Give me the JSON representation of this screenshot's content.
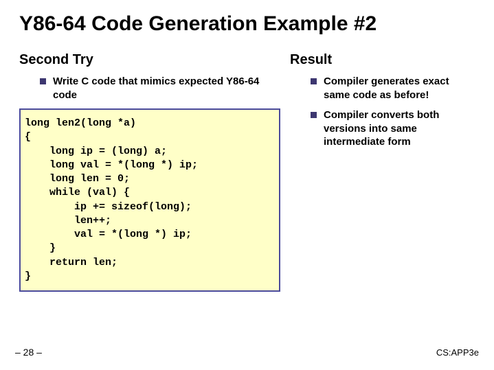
{
  "title": "Y86-64 Code Generation Example #2",
  "left": {
    "heading": "Second Try",
    "bullets": [
      "Write C code that mimics expected Y86-64 code"
    ],
    "code": "long len2(long *a)\n{\n    long ip = (long) a;\n    long val = *(long *) ip;\n    long len = 0;\n    while (val) {\n        ip += sizeof(long);\n        len++;\n        val = *(long *) ip;\n    }\n    return len;\n}"
  },
  "right": {
    "heading": "Result",
    "bullets": [
      "Compiler generates exact same code as before!",
      "Compiler converts both versions into same intermediate form"
    ]
  },
  "footer": {
    "left": "– 28 –",
    "right": "CS:APP3e"
  }
}
